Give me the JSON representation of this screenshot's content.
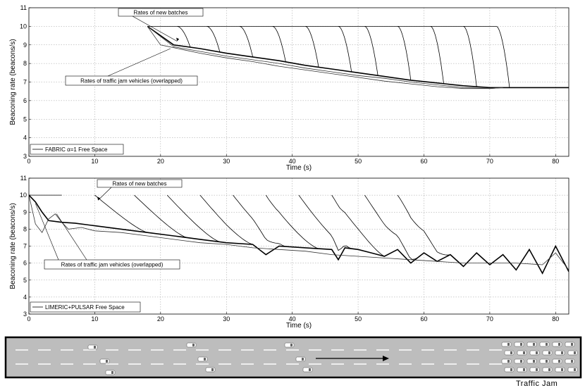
{
  "chart_data": [
    {
      "type": "line",
      "xlabel": "Time (s)",
      "ylabel": "Beaconing rate  (beacons/s)",
      "xlim": [
        0,
        82
      ],
      "ylim": [
        3,
        11
      ],
      "xticks": [
        0,
        10,
        20,
        30,
        40,
        50,
        60,
        70,
        80
      ],
      "yticks": [
        3,
        4,
        5,
        6,
        7,
        8,
        9,
        10,
        11
      ],
      "grid": true,
      "legend": {
        "placement": "bottom-left",
        "entries": [
          "FABRIC α=1 Free Space"
        ]
      },
      "annotations": [
        "Rates of new batches",
        "Rates of traffic jam vehicles (overlapped)"
      ],
      "series": [
        {
          "name": "FABRIC α=1 Free Space",
          "x": [
            0,
            18,
            22,
            26,
            30,
            34,
            38,
            42,
            46,
            50,
            54,
            58,
            62,
            66,
            70,
            72.5,
            82
          ],
          "y": [
            null,
            10,
            9.0,
            8.8,
            8.55,
            8.35,
            8.15,
            7.9,
            7.7,
            7.5,
            7.3,
            7.1,
            6.95,
            6.8,
            6.7,
            6.7,
            6.7
          ]
        },
        {
          "name": "",
          "x": [
            18,
            22,
            26,
            30,
            34,
            38,
            42,
            46,
            50,
            54,
            58,
            62,
            66,
            70,
            72
          ],
          "y": [
            10,
            8.9,
            8.65,
            8.4,
            8.2,
            8.0,
            7.75,
            7.55,
            7.35,
            7.2,
            7.0,
            6.85,
            6.7,
            6.65,
            6.7
          ]
        },
        {
          "name": "",
          "x": [
            18,
            20,
            22,
            26,
            30,
            34,
            38,
            42,
            46,
            50,
            54,
            58,
            62,
            66,
            70,
            72
          ],
          "y": [
            10,
            9.0,
            8.85,
            8.55,
            8.3,
            8.1,
            7.85,
            7.65,
            7.45,
            7.25,
            7.05,
            6.9,
            6.75,
            6.65,
            6.65,
            6.7
          ]
        }
      ],
      "new_batch_curves": {
        "start_x": [
          22.5,
          27,
          32,
          37,
          42,
          47,
          51,
          56,
          61,
          66,
          71
        ],
        "start_y": 10
      },
      "baseline_y": 10
    },
    {
      "type": "line",
      "xlabel": "Time (s)",
      "ylabel": "Beaconing rate  (beacons/s)",
      "xlim": [
        0,
        82
      ],
      "ylim": [
        3,
        11
      ],
      "xticks": [
        0,
        10,
        20,
        30,
        40,
        50,
        60,
        70,
        80
      ],
      "yticks": [
        3,
        4,
        5,
        6,
        7,
        8,
        9,
        10,
        11
      ],
      "grid": true,
      "legend": {
        "placement": "bottom-left",
        "entries": [
          "LIMERIC+PULSAR Free Space"
        ]
      },
      "annotations": [
        "Rates of new batches",
        "Rates of traffic jam vehicles (overlapped)"
      ],
      "series": [
        {
          "name": "LIMERIC+PULSAR Free Space",
          "x": [
            0,
            1,
            2,
            3,
            5,
            7,
            10,
            14,
            18,
            22,
            26,
            30,
            34,
            36,
            38,
            42,
            46,
            47,
            48,
            50,
            52,
            54,
            56,
            58,
            60,
            62,
            64,
            66,
            68,
            70,
            72,
            74,
            76,
            78,
            80,
            82
          ],
          "y": [
            10,
            9.6,
            9.0,
            8.5,
            8.4,
            8.35,
            8.2,
            8.0,
            7.8,
            7.6,
            7.4,
            7.2,
            7.1,
            6.5,
            7.0,
            6.9,
            6.8,
            6.2,
            6.9,
            6.8,
            6.6,
            6.4,
            6.8,
            6.0,
            6.6,
            6.1,
            6.5,
            5.8,
            6.6,
            5.9,
            6.5,
            5.6,
            6.8,
            5.4,
            7.0,
            5.5
          ]
        },
        {
          "name": "",
          "x": [
            0,
            1,
            2,
            3,
            4,
            5,
            6,
            8,
            10,
            14,
            18,
            22,
            26,
            30,
            34,
            38,
            42,
            46,
            50,
            54,
            58,
            62,
            66,
            70,
            74,
            78,
            80,
            82
          ],
          "y": [
            10,
            8.3,
            7.8,
            8.6,
            8.9,
            8.4,
            8.0,
            8.1,
            7.9,
            7.8,
            7.6,
            7.4,
            7.2,
            7.1,
            6.9,
            6.8,
            6.7,
            6.5,
            6.4,
            6.3,
            6.2,
            6.1,
            6.0,
            6.0,
            6.0,
            5.9,
            6.6,
            5.6
          ]
        }
      ],
      "new_batch_curves": {
        "start_x": [
          10,
          16,
          21,
          26,
          31,
          36,
          41,
          46,
          51,
          56
        ],
        "start_y": 10
      },
      "baseline_y": 10
    }
  ],
  "road": {
    "label": "Traffic Jam",
    "direction": "right"
  }
}
